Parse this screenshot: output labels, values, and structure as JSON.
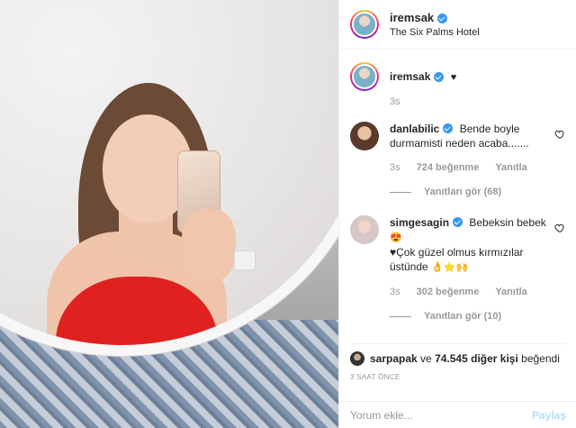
{
  "post": {
    "username": "iremsak",
    "location": "The Six Palms Hotel"
  },
  "caption": {
    "username": "iremsak",
    "heart": "♥",
    "time": "3s"
  },
  "comments": [
    {
      "username": "danlabilic",
      "text": "Bende boyle durmamisti neden acaba.......",
      "time": "3s",
      "likes": "724 beğenme",
      "reply_label": "Yanıtla",
      "replies": "Yanıtları gör (68)"
    },
    {
      "username": "simgesagin",
      "text_line1": "Bebeksin bebek",
      "text_line2": "Çok güzel olmus kırmızılar üstünde",
      "time": "3s",
      "likes": "302 beğenme",
      "reply_label": "Yanıtla",
      "replies": "Yanıtları gör (10)"
    }
  ],
  "likes_summary": {
    "user": "sarpapak",
    "middle": "ve",
    "others": "74.545 diğer kişi",
    "suffix": "beğendi"
  },
  "time_ago": "3 SAAT ÖNCE",
  "comment_box": {
    "placeholder": "Yorum ekle...",
    "post_label": "Paylaş"
  },
  "colors": {
    "verified": "#3897f0",
    "post_button": "#b2dffc",
    "meta_text": "#999999"
  }
}
